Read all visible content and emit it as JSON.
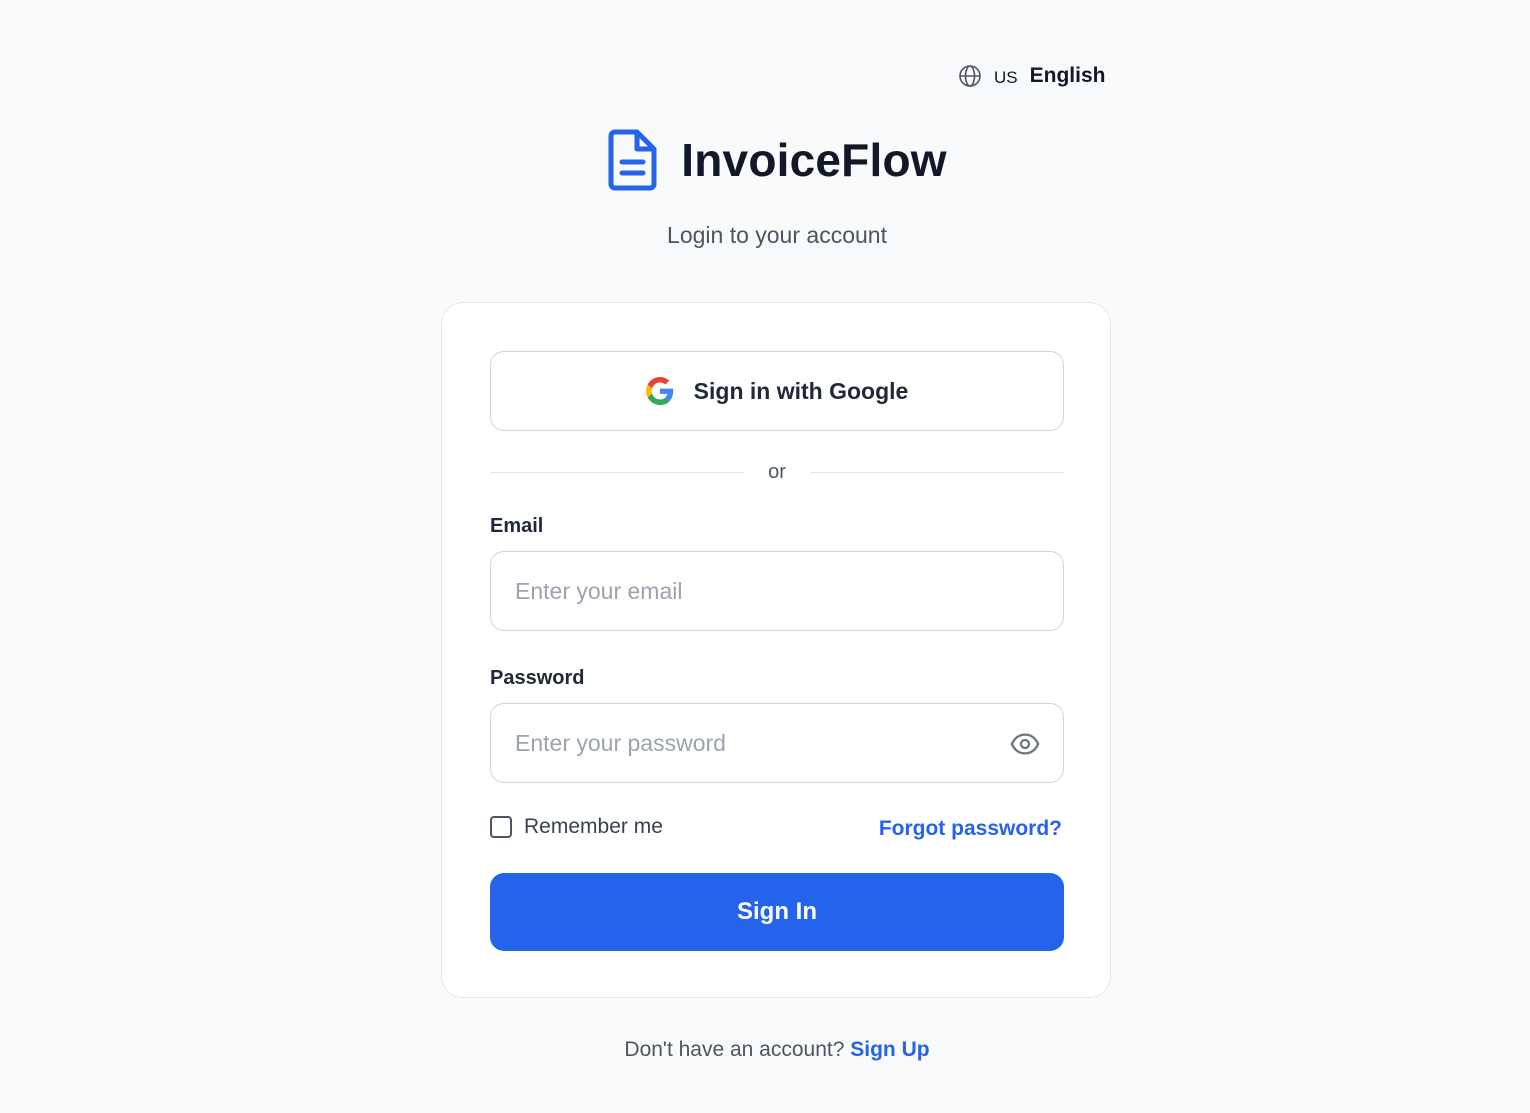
{
  "language": {
    "icon": "globe-icon",
    "flag_text": "US",
    "label": "English"
  },
  "brand": {
    "logo_icon": "document-icon",
    "name": "InvoiceFlow",
    "accent_color": "#2563eb"
  },
  "subtitle": "Login to your account",
  "google_button": {
    "icon": "google-icon",
    "label": "Sign in with Google"
  },
  "divider_text": "or",
  "email": {
    "label": "Email",
    "placeholder": "Enter your email",
    "value": ""
  },
  "password": {
    "label": "Password",
    "placeholder": "Enter your password",
    "value": "",
    "toggle_icon": "eye-icon"
  },
  "remember_me": {
    "label": "Remember me",
    "checked": false
  },
  "forgot_password": "Forgot password?",
  "submit_label": "Sign In",
  "footer": {
    "prompt": "Don't have an account?",
    "link": "Sign Up"
  }
}
